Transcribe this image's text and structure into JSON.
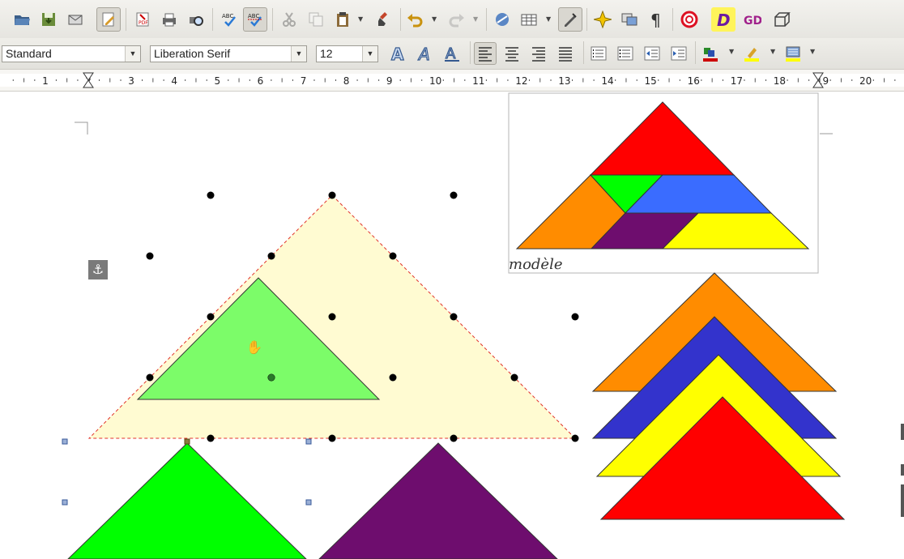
{
  "toolbar": {
    "paragraph_style": "Standard",
    "font_name": "Liberation Serif",
    "font_size": "12"
  },
  "icons": {
    "open": "folder-open-icon",
    "save": "save-icon",
    "email": "email-icon",
    "edit_mode": "edit-file-icon",
    "export_pdf": "export-pdf-icon",
    "print": "print-icon",
    "print_preview": "print-preview-icon",
    "spelling": "spelling-icon",
    "autospell": "autospellcheck-icon",
    "cut": "cut-icon",
    "copy": "copy-icon",
    "paste": "paste-icon",
    "clone": "clone-formatting-icon",
    "undo": "undo-icon",
    "redo": "redo-icon",
    "hyperlink": "hyperlink-icon",
    "table": "table-icon",
    "show_draw": "draw-functions-icon",
    "navigator": "navigator-icon",
    "gallery": "gallery-icon",
    "formatting_marks": "pilcrow-icon",
    "help": "help-icon",
    "fontwork": "fontwork-icon",
    "basic_shapes": "basic-shapes-icon",
    "cube": "3d-object-icon"
  },
  "drawing": {
    "caption": "modèle",
    "colors": {
      "red": "#ff0000",
      "orange": "#ff8c00",
      "green": "#00ff00",
      "light_green": "#7cfc69",
      "blue": "#3a6cff",
      "dark_blue": "#3333cc",
      "purple": "#6e0d6e",
      "yellow": "#ffff00",
      "pale_yellow": "#fffbd2",
      "selection_dash": "#e0332a"
    }
  }
}
